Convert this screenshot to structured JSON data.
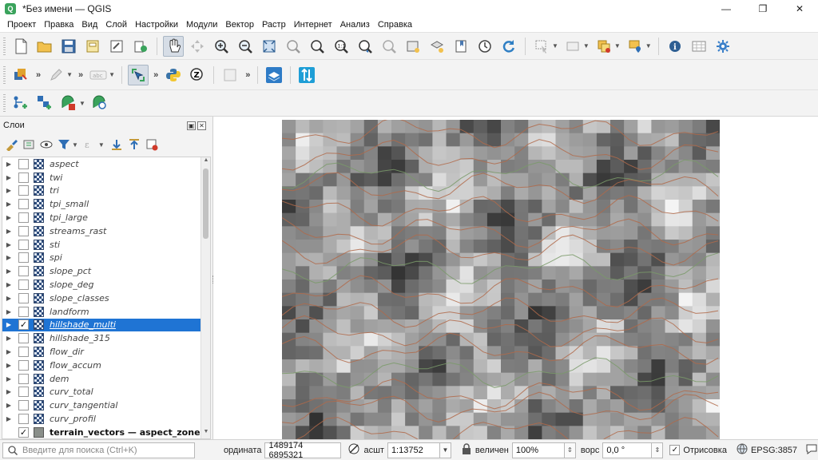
{
  "window": {
    "title": "*Без имени — QGIS",
    "minimize": "—",
    "maximize": "❐",
    "close": "✕"
  },
  "menu": [
    "Проект",
    "Правка",
    "Вид",
    "Слой",
    "Настройки",
    "Модули",
    "Вектор",
    "Растр",
    "Интернет",
    "Анализ",
    "Справка"
  ],
  "layers_panel": {
    "title": "Слои",
    "layers": [
      {
        "name": "aspect",
        "checked": false
      },
      {
        "name": "twi",
        "checked": false
      },
      {
        "name": "tri",
        "checked": false
      },
      {
        "name": "tpi_small",
        "checked": false
      },
      {
        "name": "tpi_large",
        "checked": false
      },
      {
        "name": "streams_rast",
        "checked": false
      },
      {
        "name": "sti",
        "checked": false
      },
      {
        "name": "spi",
        "checked": false
      },
      {
        "name": "slope_pct",
        "checked": false
      },
      {
        "name": "slope_deg",
        "checked": false
      },
      {
        "name": "slope_classes",
        "checked": false
      },
      {
        "name": "landform",
        "checked": false
      },
      {
        "name": "hillshade_multi",
        "checked": true,
        "selected": true
      },
      {
        "name": "hillshade_315",
        "checked": false
      },
      {
        "name": "flow_dir",
        "checked": false
      },
      {
        "name": "flow_accum",
        "checked": false
      },
      {
        "name": "dem",
        "checked": false
      },
      {
        "name": "curv_total",
        "checked": false
      },
      {
        "name": "curv_tangential",
        "checked": false
      },
      {
        "name": "curv_profil",
        "checked": false
      },
      {
        "name": "terrain_vectors — aspect_zones",
        "checked": true,
        "vector": true
      }
    ]
  },
  "statusbar": {
    "search_placeholder": "Введите для поиска (Ctrl+K)",
    "coord_label": "ордината",
    "coord_value": "1489174  6895321",
    "scale_label": "асшт",
    "scale_value": "1:13752",
    "magnifier_label": "величен",
    "magnifier_value": "100%",
    "rotation_label": "ворс",
    "rotation_value": "0,0 °",
    "render_label": "Отрисовка",
    "crs": "EPSG:3857"
  },
  "colors": {
    "selection": "#1f74d4",
    "contour": "#b06a4a",
    "contour_green": "#7a9a6a"
  }
}
